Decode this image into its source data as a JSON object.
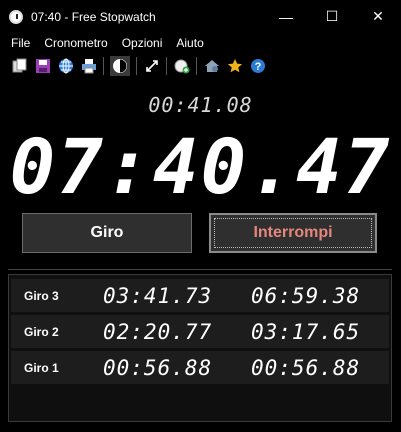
{
  "window": {
    "title": "07:40 - Free Stopwatch",
    "minimize": "—",
    "maximize": "☐",
    "close": "✕"
  },
  "menu": {
    "items": [
      "File",
      "Cronometro",
      "Opzioni",
      "Aiuto"
    ]
  },
  "toolbar": {
    "icons": [
      "copy-icon",
      "save-icon",
      "globe-icon",
      "print-icon",
      "theme-icon",
      "fullscreen-icon",
      "add-alarm-icon",
      "home-settings-icon",
      "star-icon",
      "help-icon"
    ],
    "accent": "#f2b31b"
  },
  "display": {
    "lap_time": "00:41.08",
    "main_time": "07:40.47"
  },
  "buttons": {
    "lap": "Giro",
    "stop": "Interrompi",
    "stop_color": "#e3867e"
  },
  "laps": [
    {
      "label": "Giro 3",
      "split": "03:41.73",
      "total": "06:59.38"
    },
    {
      "label": "Giro 2",
      "split": "02:20.77",
      "total": "03:17.65"
    },
    {
      "label": "Giro 1",
      "split": "00:56.88",
      "total": "00:56.88"
    }
  ]
}
